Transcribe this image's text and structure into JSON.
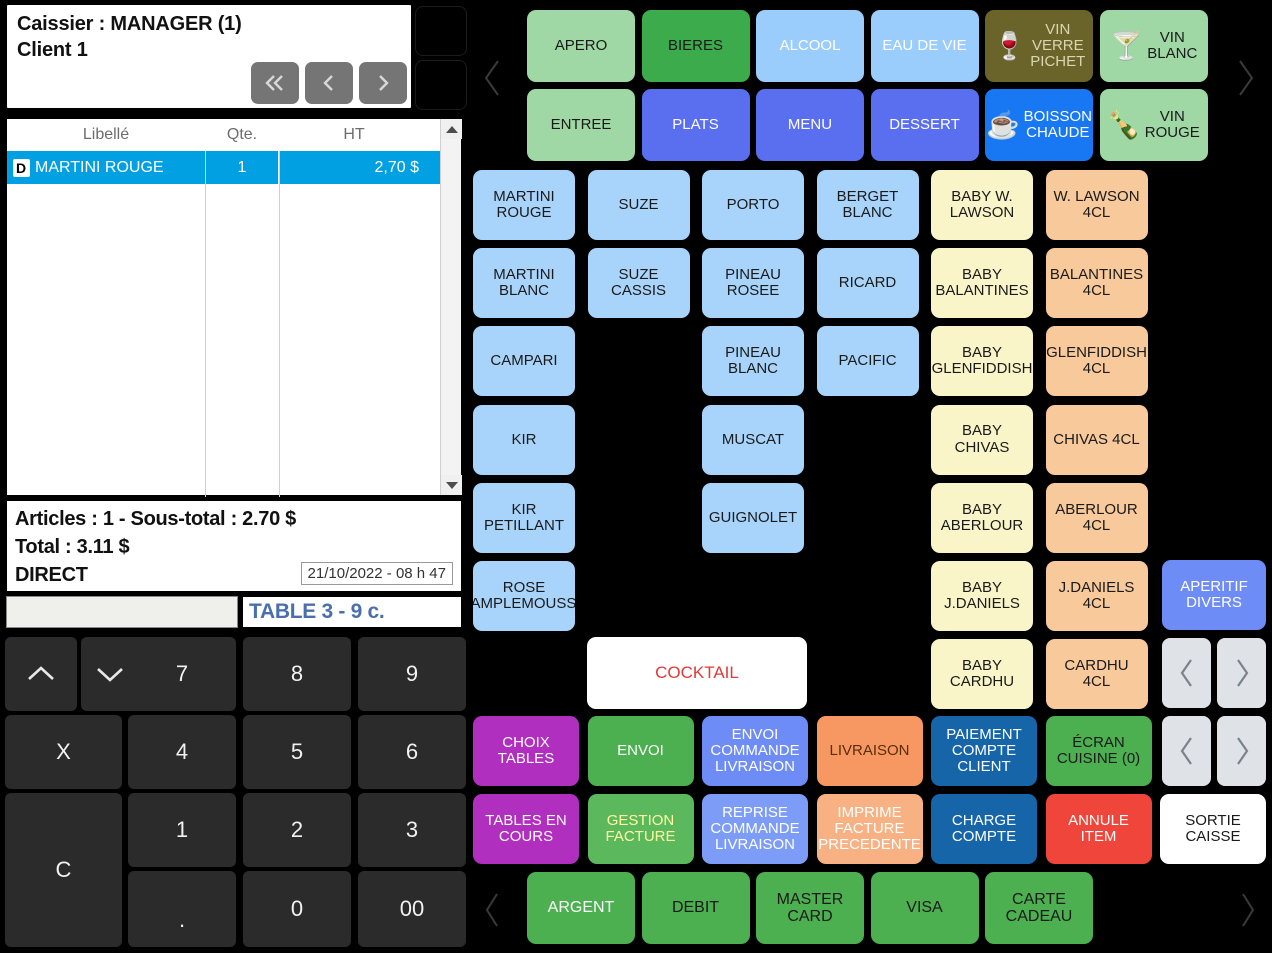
{
  "cashier": {
    "line1": "Caissier : MANAGER (1)",
    "line2": "Client 1",
    "nav": [
      {
        "name": "first-page-icon",
        "glyph": "double-left"
      },
      {
        "name": "prev-page-icon",
        "glyph": "left"
      },
      {
        "name": "next-page-icon",
        "glyph": "right"
      }
    ]
  },
  "order": {
    "columns": [
      "Libellé",
      "Qte.",
      "HT"
    ],
    "rows": [
      {
        "badge": "D",
        "label": "MARTINI ROUGE",
        "qty": "1",
        "ht": "2,70 $"
      }
    ]
  },
  "totals": {
    "line1": "Articles : 1 - Sous-total : 2.70 $",
    "line2": "Total : 3.11 $",
    "line3": "DIRECT",
    "timestamp": "21/10/2022 - 08 h 47",
    "input_value": "",
    "table_info": "TABLE 3 - 9 c."
  },
  "keypad": [
    {
      "label": "",
      "icon": "chevron-up-icon",
      "name": "key-up"
    },
    {
      "label": "",
      "icon": "chevron-down-icon",
      "name": "key-down"
    },
    {
      "label": "7",
      "name": "key-7"
    },
    {
      "label": "8",
      "name": "key-8"
    },
    {
      "label": "9",
      "name": "key-9"
    },
    {
      "label": "X",
      "name": "key-multiply"
    },
    {
      "label": "4",
      "name": "key-4"
    },
    {
      "label": "5",
      "name": "key-5"
    },
    {
      "label": "6",
      "name": "key-6"
    },
    {
      "label": "C",
      "name": "key-clear"
    },
    {
      "label": "1",
      "name": "key-1"
    },
    {
      "label": "2",
      "name": "key-2"
    },
    {
      "label": "3",
      "name": "key-3"
    },
    {
      "label": ".",
      "name": "key-decimal"
    },
    {
      "label": "0",
      "name": "key-0"
    },
    {
      "label": "00",
      "name": "key-double-zero"
    }
  ],
  "categories": [
    {
      "label": "APERO",
      "bg": "#9FD8A4",
      "fg": "#1a1a1a",
      "icon": ""
    },
    {
      "label": "BIERES",
      "bg": "#3CAB4B",
      "fg": "#1a1a1a",
      "icon": ""
    },
    {
      "label": "ALCOOL",
      "bg": "#9ACDFB",
      "fg": "#ffffff",
      "icon": ""
    },
    {
      "label": "EAU DE VIE",
      "bg": "#9ACDFB",
      "fg": "#ffffff",
      "icon": ""
    },
    {
      "label": "VIN\nVERRE\nPICHET",
      "bg": "#6B642A",
      "fg": "#D9D6B0",
      "icon": "🍷"
    },
    {
      "label": "VIN\nBLANC",
      "bg": "#9FD8A4",
      "fg": "#1a1a1a",
      "icon": "🍸"
    },
    {
      "label": "ENTREE",
      "bg": "#9FD8A4",
      "fg": "#1a1a1a",
      "icon": ""
    },
    {
      "label": "PLATS",
      "bg": "#5A6FF0",
      "fg": "#ffffff",
      "icon": ""
    },
    {
      "label": "MENU",
      "bg": "#5A6FF0",
      "fg": "#ffffff",
      "icon": ""
    },
    {
      "label": "DESSERT",
      "bg": "#5A6FF0",
      "fg": "#ffffff",
      "icon": ""
    },
    {
      "label": "BOISSON\nCHAUDE",
      "bg": "#1877F2",
      "fg": "#ffffff",
      "icon": "☕"
    },
    {
      "label": "VIN\nROUGE",
      "bg": "#9FD8A4",
      "fg": "#1a1a1a",
      "icon": "🍾"
    }
  ],
  "products": [
    {
      "label": "MARTINI\nROUGE",
      "col": 0,
      "row": 0,
      "bg": "#A8D4FB"
    },
    {
      "label": "SUZE",
      "col": 1,
      "row": 0,
      "bg": "#A8D4FB"
    },
    {
      "label": "PORTO",
      "col": 2,
      "row": 0,
      "bg": "#A8D4FB"
    },
    {
      "label": "BERGET\nBLANC",
      "col": 3,
      "row": 0,
      "bg": "#A8D4FB"
    },
    {
      "label": "BABY W.\nLAWSON",
      "col": 4,
      "row": 0,
      "bg": "#FAF5C8"
    },
    {
      "label": "W. LAWSON\n4CL",
      "col": 5,
      "row": 0,
      "bg": "#F8C99B"
    },
    {
      "label": "MARTINI\nBLANC",
      "col": 0,
      "row": 1,
      "bg": "#A8D4FB"
    },
    {
      "label": "SUZE CASSIS",
      "col": 1,
      "row": 1,
      "bg": "#A8D4FB"
    },
    {
      "label": "PINEAU\nROSEE",
      "col": 2,
      "row": 1,
      "bg": "#A8D4FB"
    },
    {
      "label": "RICARD",
      "col": 3,
      "row": 1,
      "bg": "#A8D4FB"
    },
    {
      "label": "BABY\nBALANTINES",
      "col": 4,
      "row": 1,
      "bg": "#FAF5C8"
    },
    {
      "label": "BALANTINES\n4CL",
      "col": 5,
      "row": 1,
      "bg": "#F8C99B"
    },
    {
      "label": "CAMPARI",
      "col": 0,
      "row": 2,
      "bg": "#A8D4FB"
    },
    {
      "label": "PINEAU\nBLANC",
      "col": 2,
      "row": 2,
      "bg": "#A8D4FB"
    },
    {
      "label": "PACIFIC",
      "col": 3,
      "row": 2,
      "bg": "#A8D4FB"
    },
    {
      "label": "BABY\nGLENFIDDISH",
      "col": 4,
      "row": 2,
      "bg": "#FAF5C8"
    },
    {
      "label": "GLENFIDDISH\n4CL",
      "col": 5,
      "row": 2,
      "bg": "#F8C99B"
    },
    {
      "label": "KIR",
      "col": 0,
      "row": 3,
      "bg": "#A8D4FB"
    },
    {
      "label": "MUSCAT",
      "col": 2,
      "row": 3,
      "bg": "#A8D4FB"
    },
    {
      "label": "BABY\nCHIVAS",
      "col": 4,
      "row": 3,
      "bg": "#FAF5C8"
    },
    {
      "label": "CHIVAS 4CL",
      "col": 5,
      "row": 3,
      "bg": "#F8C99B"
    },
    {
      "label": "KIR\nPETILLANT",
      "col": 0,
      "row": 4,
      "bg": "#A8D4FB"
    },
    {
      "label": "GUIGNOLET",
      "col": 2,
      "row": 4,
      "bg": "#A8D4FB"
    },
    {
      "label": "BABY\nABERLOUR",
      "col": 4,
      "row": 4,
      "bg": "#FAF5C8"
    },
    {
      "label": "ABERLOUR\n4CL",
      "col": 5,
      "row": 4,
      "bg": "#F8C99B"
    },
    {
      "label": "ROSE\nPAMPLEMOUSSE",
      "col": 0,
      "row": 5,
      "bg": "#A8D4FB"
    },
    {
      "label": "BABY\nJ.DANIELS",
      "col": 4,
      "row": 5,
      "bg": "#FAF5C8"
    },
    {
      "label": "J.DANIELS\n4CL",
      "col": 5,
      "row": 5,
      "bg": "#F8C99B"
    },
    {
      "label": "BABY\nCARDHU",
      "col": 4,
      "row": 6,
      "bg": "#FAF5C8"
    },
    {
      "label": "CARDHU\n4CL",
      "col": 5,
      "row": 6,
      "bg": "#F8C99B"
    }
  ],
  "cocktail_button": {
    "label": "COCKTAIL",
    "bg": "#ffffff",
    "fg": "#E03A3A"
  },
  "aperitif_divers": {
    "label": "APERITIF\nDIVERS",
    "bg": "#6E8CF5",
    "fg": "#ffffff"
  },
  "side_arrows": [
    {
      "name": "products-prev-arrow",
      "glyph": "left"
    },
    {
      "name": "products-next-arrow",
      "glyph": "right"
    }
  ],
  "functions_row1": [
    {
      "label": "CHOIX\nTABLES",
      "bg": "#B party",
      "fg": "#ffffff"
    },
    {
      "label": "ENVOI",
      "bg": "#4CAF50",
      "fg": "#ffffff"
    },
    {
      "label": "ENVOI\nCOMMANDE\nLIVRAISON",
      "bg": "#6E8CF5",
      "fg": "#ffffff"
    },
    {
      "label": "LIVRAISON",
      "bg": "#F79862",
      "fg": "#5a2d0c"
    },
    {
      "label": "PAIEMENT\nCOMPTE\nCLIENT",
      "bg": "#1565A8",
      "fg": "#ffffff"
    },
    {
      "label": "ÉCRAN\nCUISINE (0)",
      "bg": "#4CAF50",
      "fg": "#1a1a1a"
    }
  ],
  "functions_row2": [
    {
      "label": "TABLES EN\nCOURS",
      "bg": "#B12FBF",
      "fg": "#ffffff"
    },
    {
      "label": "GESTION\nFACTURE",
      "bg": "#5CB85C",
      "fg": "#ffffa0"
    },
    {
      "label": "REPRISE\nCOMMANDE\nLIVRAISON",
      "bg": "#7C9CF7",
      "fg": "#ffffff"
    },
    {
      "label": "IMPRIME\nFACTURE\nPRECEDENTE",
      "bg": "#F8B183",
      "fg": "#ffffff"
    },
    {
      "label": "CHARGE\nCOMPTE",
      "bg": "#1565A8",
      "fg": "#ffffff"
    },
    {
      "label": "ANNULE\nITEM",
      "bg": "#F0453A",
      "fg": "#ffffff"
    },
    {
      "label": "SORTIE\nCAISSE",
      "bg": "#ffffff",
      "fg": "#1a1a1a"
    }
  ],
  "fn_arrows": [
    {
      "name": "functions-prev-arrow",
      "glyph": "left"
    },
    {
      "name": "functions-next-arrow",
      "glyph": "right"
    }
  ],
  "payments": [
    {
      "label": "ARGENT",
      "bg": "#4CAF50",
      "fg": "#ffffff"
    },
    {
      "label": "DEBIT",
      "bg": "#4CAF50",
      "fg": "#1a1a1a"
    },
    {
      "label": "MASTER\nCARD",
      "bg": "#4CAF50",
      "fg": "#1a1a1a"
    },
    {
      "label": "VISA",
      "bg": "#4CAF50",
      "fg": "#1a1a1a"
    },
    {
      "label": "CARTE\nCADEAU",
      "bg": "#4CAF50",
      "fg": "#1a1a1a"
    }
  ],
  "edge_arrows": {
    "cat_left": "left",
    "cat_right": "right",
    "pay_left": "left",
    "pay_right": "right"
  },
  "colors": {
    "selected_row": "#00A0E3",
    "background": "#000000",
    "choix_tables": "#B12FBF"
  }
}
